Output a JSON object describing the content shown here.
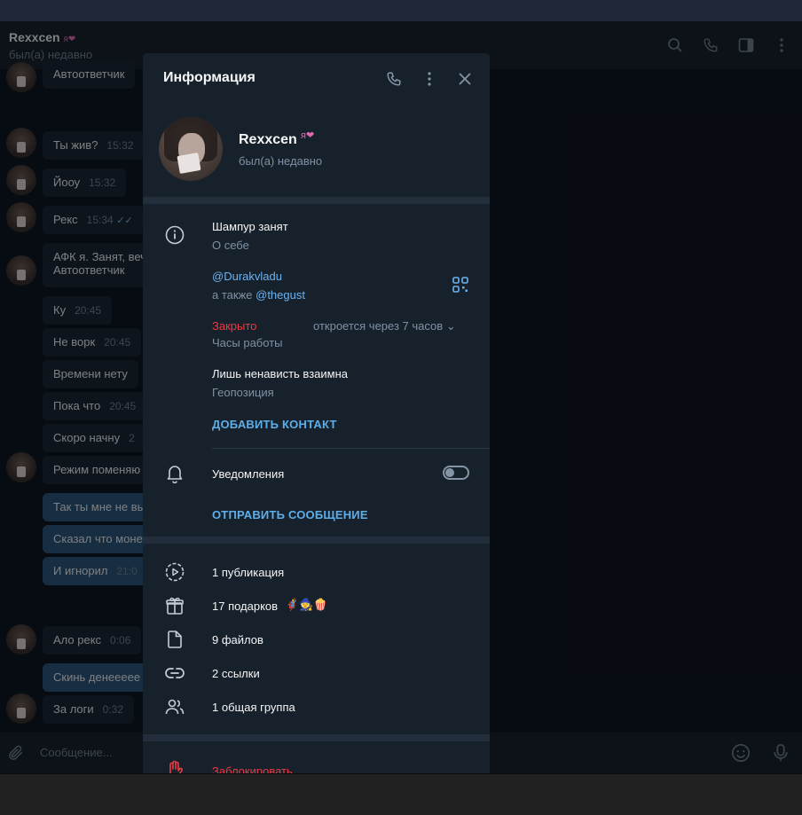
{
  "chat_header": {
    "name": "Rexxcen",
    "badge": "я❤",
    "status": "был(а) недавно"
  },
  "messages": [
    {
      "text": "Автоответчик",
      "time": ""
    },
    {
      "text": "Ты жив?",
      "time": "15:32"
    },
    {
      "text": "Йооу",
      "time": "15:32"
    },
    {
      "text": "Рекс",
      "time": "15:34"
    },
    {
      "text": "АФК я. Занят, веч",
      "time": ""
    },
    {
      "text": "Автоответчик",
      "time": ""
    },
    {
      "text": "Ку",
      "time": "20:45"
    },
    {
      "text": "Не ворк",
      "time": "20:45"
    },
    {
      "text": "Времени нету",
      "time": ""
    },
    {
      "text": "Пока что",
      "time": "20:45"
    },
    {
      "text": "Скоро начну",
      "time": "2"
    },
    {
      "text": "Режим поменяю",
      "time": ""
    },
    {
      "text": "Так ты мне не вы",
      "time": ""
    },
    {
      "text": "Сказал что моне",
      "time": ""
    },
    {
      "text": "И игнорил",
      "time": "21:0"
    },
    {
      "text": "Ало рекс",
      "time": "0:06"
    },
    {
      "text": "Скинь денееееe",
      "time": ""
    },
    {
      "text": "За логи",
      "time": "0:32"
    }
  ],
  "composer": {
    "placeholder": "Сообщение..."
  },
  "panel": {
    "title": "Информация",
    "profile": {
      "name": "Rexxcen",
      "badge": "я❤",
      "status": "был(а) недавно"
    },
    "bio": {
      "value": "Шампур занят",
      "label": "О себе"
    },
    "username": {
      "value": "@Durakvladu",
      "also_prefix": "а также",
      "also_value": "@thegust"
    },
    "hours": {
      "status": "Закрыто",
      "label": "Часы работы",
      "opens": "откроется через 7 часов"
    },
    "location": {
      "value": "Лишь ненависть взаимна",
      "label": "Геопозиция"
    },
    "add_contact": "ДОБАВИТЬ КОНТАКТ",
    "notifications": {
      "label": "Уведомления",
      "enabled": false
    },
    "send_message": "ОТПРАВИТЬ СООБЩЕНИЕ",
    "media": [
      {
        "icon": "stories-icon",
        "label": "1 публикация"
      },
      {
        "icon": "gift-icon",
        "label": "17 подарков"
      },
      {
        "icon": "file-icon",
        "label": "9 файлов"
      },
      {
        "icon": "link-icon",
        "label": "2 ссылки"
      },
      {
        "icon": "group-icon",
        "label": "1 общая группа"
      }
    ],
    "gift_emojis": "🦸🧙🍿",
    "block": "Заблокировать"
  },
  "colors": {
    "accent": "#5eaee9",
    "link": "#6ab3f3",
    "danger": "#ec3942",
    "panel_bg": "#17212b",
    "chat_bg": "#0e1621"
  }
}
